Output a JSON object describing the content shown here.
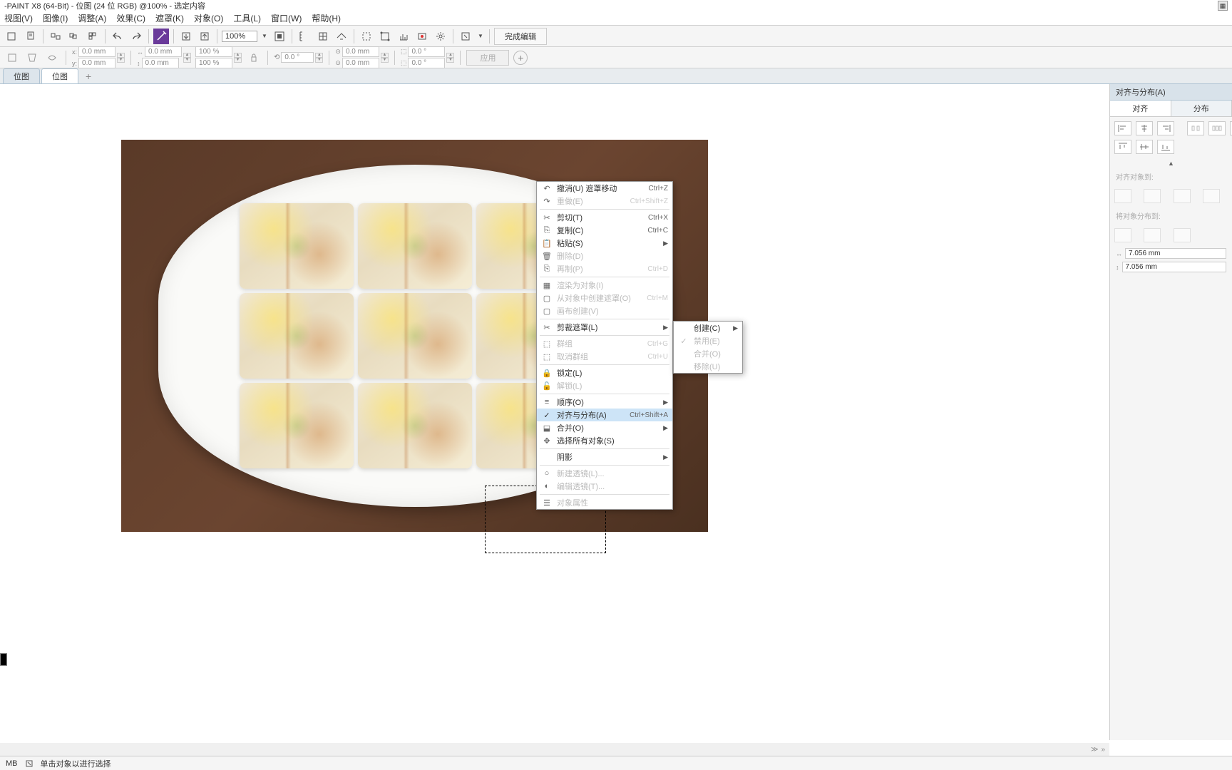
{
  "title": "-PAINT X8 (64-Bit) - 位图 (24 位 RGB) @100% - 选定内容",
  "menu": [
    "视图(V)",
    "图像(I)",
    "调整(A)",
    "效果(C)",
    "遮罩(K)",
    "对象(O)",
    "工具(L)",
    "窗口(W)",
    "帮助(H)"
  ],
  "zoom": "100%",
  "finish_edit": "完成编辑",
  "apply": "应用",
  "prop": {
    "x": "0.0 mm",
    "y": "0.0 mm",
    "w": "0.0 mm",
    "h": "0.0 mm",
    "sx": "100 %",
    "sy": "100 %",
    "rot": "0.0 °",
    "r1": "0.0 mm",
    "r2": "0.0 mm",
    "sk1": "0.0 °",
    "sk2": "0.0 °"
  },
  "tabs": [
    "位图",
    "位图"
  ],
  "context_menu": [
    {
      "icon": "undo",
      "label": "撤消(U) 遮罩移动",
      "shortcut": "Ctrl+Z",
      "enabled": true
    },
    {
      "icon": "redo",
      "label": "重做(E)",
      "shortcut": "Ctrl+Shift+Z",
      "enabled": false
    },
    {
      "sep": true
    },
    {
      "icon": "cut",
      "label": "剪切(T)",
      "shortcut": "Ctrl+X",
      "enabled": true
    },
    {
      "icon": "copy",
      "label": "复制(C)",
      "shortcut": "Ctrl+C",
      "enabled": true
    },
    {
      "icon": "paste",
      "label": "粘贴(S)",
      "submenu": true,
      "enabled": true
    },
    {
      "icon": "trash",
      "label": "删除(D)",
      "enabled": false
    },
    {
      "icon": "dup",
      "label": "再制(P)",
      "shortcut": "Ctrl+D",
      "enabled": false
    },
    {
      "sep": true
    },
    {
      "icon": "fill",
      "label": "渲染为对象(I)",
      "enabled": false
    },
    {
      "icon": "mask",
      "label": "从对象中创建遮罩(O)",
      "shortcut": "Ctrl+M",
      "enabled": false
    },
    {
      "icon": "paste2",
      "label": "画布创建(V)",
      "enabled": false
    },
    {
      "sep": true
    },
    {
      "icon": "crop",
      "label": "剪裁遮罩(L)",
      "submenu": true,
      "enabled": true
    },
    {
      "sep": true
    },
    {
      "icon": "group",
      "label": "群组",
      "shortcut": "Ctrl+G",
      "enabled": false
    },
    {
      "icon": "ungroup",
      "label": "取消群组",
      "shortcut": "Ctrl+U",
      "enabled": false
    },
    {
      "sep": true
    },
    {
      "icon": "lock",
      "label": "锁定(L)",
      "enabled": true
    },
    {
      "icon": "unlock",
      "label": "解锁(L)",
      "enabled": false
    },
    {
      "sep": true
    },
    {
      "icon": "order",
      "label": "顺序(O)",
      "submenu": true,
      "enabled": true
    },
    {
      "icon": "align",
      "label": "对齐与分布(A)",
      "shortcut": "Ctrl+Shift+A",
      "enabled": true,
      "hover": true,
      "check": true
    },
    {
      "icon": "merge",
      "label": "合并(O)",
      "submenu": true,
      "enabled": true
    },
    {
      "icon": "selall",
      "label": "选择所有对象(S)",
      "enabled": true
    },
    {
      "sep": true
    },
    {
      "icon": "shadow",
      "label": "阴影",
      "submenu": true,
      "enabled": true
    },
    {
      "sep": true
    },
    {
      "icon": "lens1",
      "label": "新建透镜(L)...",
      "enabled": false
    },
    {
      "icon": "lens2",
      "label": "编辑透镜(T)...",
      "enabled": false
    },
    {
      "sep": true
    },
    {
      "icon": "props",
      "label": "对象属性",
      "enabled": false
    }
  ],
  "sub_menu": [
    {
      "label": "创建(C)",
      "submenu": true,
      "enabled": true
    },
    {
      "label": "禁用(E)",
      "enabled": false,
      "check": true
    },
    {
      "label": "合并(O)",
      "enabled": false
    },
    {
      "label": "移除(U)",
      "enabled": false
    }
  ],
  "panel": {
    "title": "对齐与分布(A)",
    "tab_align": "对齐",
    "tab_dist": "分布",
    "sub1": "对齐对象到:",
    "sub2": "将对象分布到:",
    "val1": "7.056 mm",
    "val2": "7.056 mm"
  },
  "status": {
    "left": "MB",
    "hint": "单击对象以进行选择"
  }
}
